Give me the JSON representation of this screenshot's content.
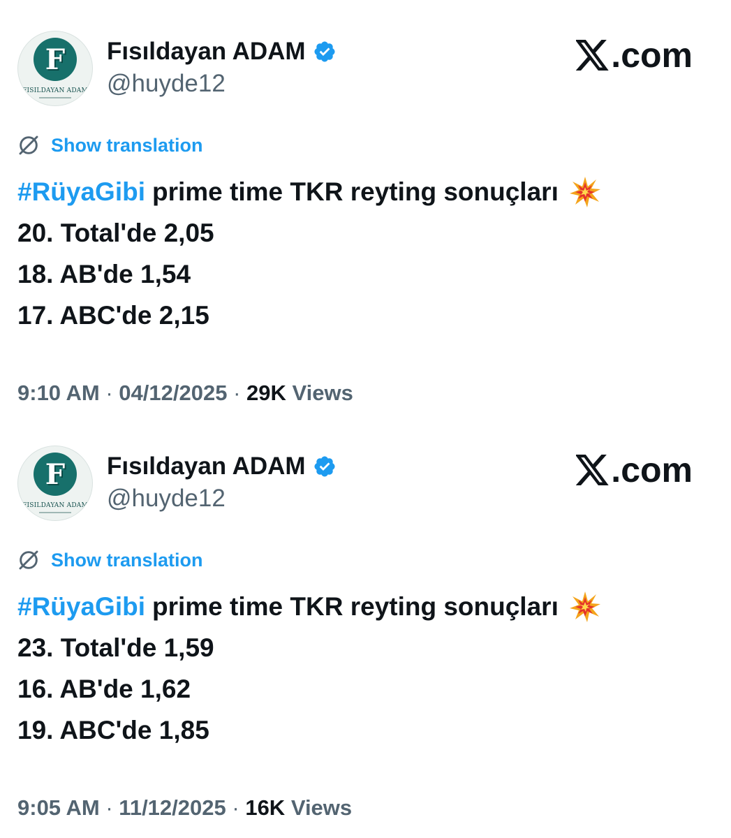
{
  "tweets": [
    {
      "author": {
        "display_name": "Fısıldayan ADAM",
        "handle": "@huyde12",
        "avatar_letter": "F",
        "avatar_caption": "FISILDAYAN ADAM",
        "verified": true
      },
      "brand": ".com",
      "translation_label": "Show translation",
      "hashtag": "#RüyaGibi",
      "headline": "prime time TKR reyting sonuçları",
      "lines": [
        "20. Total'de 2,05",
        "18. AB'de 1,54",
        "17. ABC'de 2,15"
      ],
      "time": "9:10 AM",
      "separator": "·",
      "date": "04/12/2025",
      "views_count": "29K",
      "views_label": "Views"
    },
    {
      "author": {
        "display_name": "Fısıldayan ADAM",
        "handle": "@huyde12",
        "avatar_letter": "F",
        "avatar_caption": "FISILDAYAN ADAM",
        "verified": true
      },
      "brand": ".com",
      "translation_label": "Show translation",
      "hashtag": "#RüyaGibi",
      "headline": "prime time TKR reyting sonuçları",
      "lines": [
        "23. Total'de 1,59",
        "16. AB'de 1,62",
        "19. ABC'de 1,85"
      ],
      "time": "9:05 AM",
      "separator": "·",
      "date": "11/12/2025",
      "views_count": "16K",
      "views_label": "Views"
    }
  ],
  "icons": {
    "verified": "verified-badge-icon",
    "brand_logo": "x-logo-icon",
    "translation": "globe-icon",
    "emoji": "collision-emoji-icon"
  },
  "colors": {
    "link": "#1d9bf0",
    "text": "#0f1419",
    "secondary": "#536471",
    "avatar": "#17706b"
  }
}
